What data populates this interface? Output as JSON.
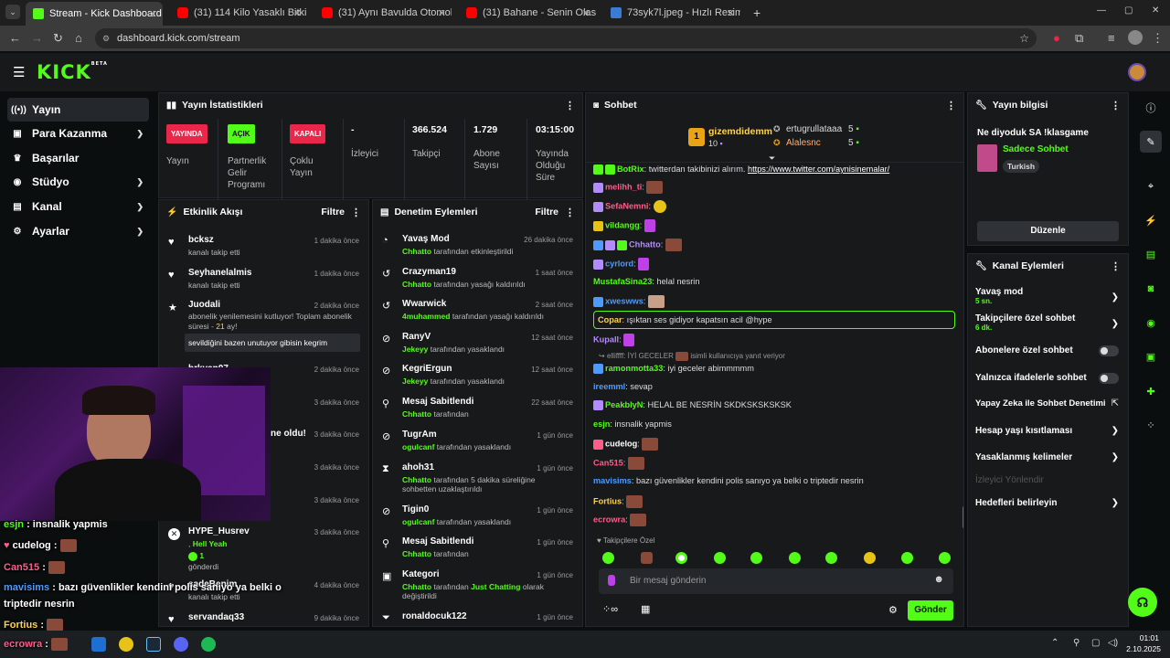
{
  "browser": {
    "tabs": [
      {
        "label": "Stream - Kick Dashboard",
        "icon": "kick-icon"
      },
      {
        "label": "(31) 114 Kilo Yasaklı Bitki Yakala",
        "icon": "youtube-icon"
      },
      {
        "label": "(31) Aynı Bavulda Otomobil Par",
        "icon": "youtube-icon"
      },
      {
        "label": "(31) Bahane - Senin Olasım Var",
        "icon": "youtube-icon"
      },
      {
        "label": "73syk7l.jpeg - Hızlı Resim",
        "icon": "image-icon"
      }
    ],
    "url": "dashboard.kick.com/stream"
  },
  "header": {
    "logo": "KICK",
    "beta": "BETA"
  },
  "sidebar": {
    "items": [
      {
        "label": "Yayın",
        "icon": "broadcast-icon",
        "active": true
      },
      {
        "label": "Para Kazanma",
        "icon": "money-icon",
        "chevron": true
      },
      {
        "label": "Başarılar",
        "icon": "trophy-icon"
      },
      {
        "label": "Stüdyo",
        "icon": "studio-icon",
        "chevron": true
      },
      {
        "label": "Kanal",
        "icon": "channel-icon",
        "chevron": true
      },
      {
        "label": "Ayarlar",
        "icon": "gear-icon",
        "chevron": true
      }
    ]
  },
  "stats": {
    "title": "Yayın İstatistikleri",
    "items": [
      {
        "badge": "YAYINDA",
        "label": "Yayın",
        "color": "#e8274b"
      },
      {
        "badge": "AÇIK",
        "label": "Partnerlik Gelir Programı",
        "color": "#53fc18"
      },
      {
        "badge": "KAPALI",
        "label": "Çoklu Yayın",
        "color": "#e8274b"
      },
      {
        "value": "-",
        "label": "İzleyici"
      },
      {
        "value": "366.524",
        "label": "Takipçi"
      },
      {
        "value": "1.729",
        "label": "Abone Sayısı"
      },
      {
        "value": "03:15:00",
        "label": "Yayında Olduğu Süre"
      }
    ]
  },
  "activity": {
    "title": "Etkinlik Akışı",
    "filter": "Filtre",
    "items": [
      {
        "name": "bcksz",
        "sub": "kanalı takip etti",
        "time": "1 dakika önce"
      },
      {
        "name": "Seyhanelalmis",
        "sub": "kanalı takip etti",
        "time": "1 dakika önce"
      },
      {
        "name": "Juodali",
        "sub": "abonelik yenilemesini kutluyor! Toplam abonelik süresi -",
        "months": "21",
        "sub_end": "ay!",
        "time": "2 dakika önce",
        "message": "sevildiğini bazen unutuyor gibisin kegrim"
      },
      {
        "name": "brkyan07",
        "time": "2 dakika önce"
      },
      {
        "time": "3 dakika önce"
      },
      {
        "sub": "ne oldu!",
        "time": "3 dakika önce"
      },
      {
        "time": "3 dakika önce"
      },
      {
        "time": "3 dakika önce"
      },
      {
        "name": "HYPE_Husrev",
        "sub": ",",
        "kudo": "Hell Yeah",
        "count": "1",
        "sub2": "gönderdi",
        "time": "3 dakika önce"
      },
      {
        "name": "sadeBenim",
        "sub": "kanalı takip etti",
        "time": "4 dakika önce"
      },
      {
        "name": "servandaq33",
        "time": "9 dakika önce"
      }
    ]
  },
  "moderation": {
    "title": "Denetim Eylemleri",
    "filter": "Filtre",
    "items": [
      {
        "title": "Yavaş Mod",
        "actor": "Chhatto",
        "text": "tarafından etkinleştirildi",
        "time": "26 dakika önce"
      },
      {
        "title": "Crazyman19",
        "actor": "Chhatto",
        "text": "tarafından yasağı kaldırıldı",
        "time": "1 saat önce"
      },
      {
        "title": "Wwarwick",
        "actor": "4muhammed",
        "text": "tarafından yasağı kaldırıldı",
        "time": "2 saat önce"
      },
      {
        "title": "RanyV",
        "actor": "Jekeyy",
        "text": "tarafından yasaklandı",
        "time": "12 saat önce"
      },
      {
        "title": "KegriErgun",
        "actor": "Jekeyy",
        "text": "tarafından yasaklandı",
        "time": "12 saat önce"
      },
      {
        "title": "Mesaj Sabitlendi",
        "actor": "Chhatto",
        "text": "tarafından",
        "time": "22 saat önce"
      },
      {
        "title": "TugrAm",
        "actor": "ogulcanf",
        "text": "tarafından yasaklandı",
        "time": "1 gün önce"
      },
      {
        "title": "ahoh31",
        "actor": "Chhatto",
        "text": "tarafından 5 dakika süreliğine sohbetten uzaklaştırıldı",
        "time": "1 gün önce"
      },
      {
        "title": "Tigin0",
        "actor": "ogulcanf",
        "text": "tarafından yasaklandı",
        "time": "1 gün önce"
      },
      {
        "title": "Mesaj Sabitlendi",
        "actor": "Chhatto",
        "text": "tarafından",
        "time": "1 gün önce"
      },
      {
        "title": "Kategori",
        "actor": "Chhatto",
        "text": "tarafından",
        "text_mid": "Just Chatting",
        "text_end": "olarak değiştirildi",
        "time": "1 gün önce"
      },
      {
        "title": "ronaldocuk122",
        "time": "1 gün önce"
      }
    ]
  },
  "chat": {
    "title": "Sohbet",
    "leaders": [
      {
        "name": "gizemdidemm",
        "count": "10",
        "rank": "1"
      },
      {
        "name": "ertugrullataaa",
        "count": "5"
      },
      {
        "name": "Alalesnc",
        "count": "5"
      }
    ],
    "messages": [
      {
        "user": "BotRix",
        "color": "#53fc18",
        "text": "twitterdan takibinizi alırım.",
        "link": "https://www.twitter.com/aynisinemalar/"
      },
      {
        "user": "melihh_ti",
        "color": "#ff5c8a",
        "text": "",
        "emote": true
      },
      {
        "user": "SefaNemni",
        "color": "#ff5c8a",
        "text": "",
        "emote": true
      },
      {
        "user": "vildangg",
        "color": "#53fc18",
        "text": "",
        "emote": true
      },
      {
        "user": "Chhatto",
        "color": "#b28cff",
        "text": "",
        "emote": true
      },
      {
        "user": "cyrlord",
        "color": "#4d9bff",
        "text": "",
        "emote": true
      },
      {
        "user": "MustafaSina23",
        "color": "#53fc18",
        "text": "helal nesrin"
      },
      {
        "user": "xweswws",
        "color": "#4d9bff",
        "text": "",
        "emote": true
      },
      {
        "user": "Copar",
        "color": "#ffd34d",
        "text": "ışıktan ses gidiyor kapatsın acil @hype",
        "highlight": true
      },
      {
        "user": "Kupall",
        "color": "#b28cff",
        "text": "",
        "emote": true
      },
      {
        "reply": "elliffff: İYİ GECELER",
        "reply_end": "isimli kullanıcıya yanıt veriyor"
      },
      {
        "user": "ramonmotta33",
        "color": "#53fc18",
        "text": "iyi geceler abimmmmm"
      },
      {
        "user": "ireemml",
        "color": "#4d9bff",
        "text": "sevap"
      },
      {
        "user": "PeakblyN",
        "color": "#53fc18",
        "text": "HELAL BE NESRİN SKDKSKSKSKSK"
      },
      {
        "user": "esjn",
        "color": "#53fc18",
        "text": "insnalik yapmis"
      },
      {
        "user": "cudelog",
        "color": "#ffffff",
        "text": "",
        "emote": true
      },
      {
        "user": "Can515",
        "color": "#ff5c8a",
        "text": "",
        "emote": true
      },
      {
        "user": "mavisims",
        "color": "#4d9bff",
        "text": "bazı güvenlikler kendini polis sanıyo ya belki o triptedir nesrin"
      },
      {
        "user": "Fortius",
        "color": "#ffd34d",
        "text": "",
        "emote": true
      },
      {
        "user": "ecrowra",
        "color": "#ff5c8a",
        "text": "",
        "emote": true
      }
    ],
    "mode": "Takipçilere Özel",
    "placeholder": "Bir mesaj gönderin",
    "send": "Gönder"
  },
  "stream_info": {
    "title": "Yayın bilgisi",
    "stream_title": "Ne diyoduk SA !klasgame",
    "category": "Sadece Sohbet",
    "tag": "Turkish",
    "edit": "Düzenle"
  },
  "channel_actions": {
    "title": "Kanal Eylemleri",
    "items": [
      {
        "label": "Yavaş mod",
        "sub": "5 sn.",
        "type": "chevron"
      },
      {
        "label": "Takipçilere özel sohbet",
        "sub": "6 dk.",
        "type": "chevron"
      },
      {
        "label": "Abonelere özel sohbet",
        "type": "toggle"
      },
      {
        "label": "Yalnızca ifadelerle sohbet",
        "type": "toggle"
      },
      {
        "label": "Yapay Zeka ile Sohbet Denetimi",
        "type": "external"
      },
      {
        "label": "Hesap yaşı kısıtlaması",
        "type": "chevron"
      },
      {
        "label": "Yasaklanmış kelimeler",
        "type": "chevron"
      },
      {
        "label": "İzleyici Yönlendir",
        "type": "disabled"
      },
      {
        "label": "Hedefleri belirleyin",
        "type": "chevron"
      }
    ]
  },
  "overlay_chat": [
    {
      "user": "esjn",
      "text": "insnalik yapmis",
      "color": "#53fc18"
    },
    {
      "user": "cudelog",
      "text": "",
      "color": "#ffffff"
    },
    {
      "user": "Can515",
      "text": "",
      "color": "#ff5c8a"
    },
    {
      "user": "mavisims",
      "text": "bazı güvenlikler kendini polis sanıyo ya belki o",
      "color": "#4d9bff"
    },
    {
      "text": "triptedir nesrin"
    },
    {
      "user": "Fortius",
      "text": "",
      "color": "#ffd34d"
    },
    {
      "user": "ecrowra",
      "text": "",
      "color": "#ff5c8a"
    }
  ],
  "taskbar": {
    "time": "01:01",
    "date": "2.10.2025"
  },
  "colors": {
    "accent": "#53fc18",
    "live": "#e8274b",
    "panel": "#18191b"
  }
}
